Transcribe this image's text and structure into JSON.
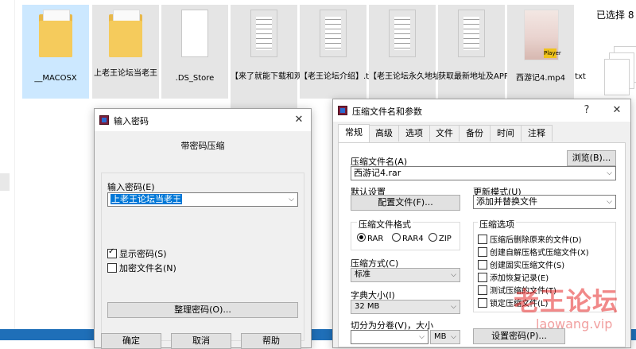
{
  "explorer": {
    "files": [
      {
        "name": "__MACOSX",
        "kind": "folder",
        "selected": true
      },
      {
        "name": "上老王论坛当老王",
        "kind": "folder",
        "selected": false
      },
      {
        "name": ".DS_Store",
        "kind": "doc",
        "selected": false
      },
      {
        "name": "【来了就能下载和观看的论坛,纯免费！】.txt",
        "kind": "txt",
        "selected": false
      },
      {
        "name": "【老王论坛介绍】.txt",
        "kind": "txt",
        "selected": false
      },
      {
        "name": "【老王论坛永久地址发布页】.txt",
        "kind": "txt",
        "selected": false
      },
      {
        "name": "获取最新地址及APP请发邮箱自动获取.txt",
        "kind": "txt",
        "selected": false
      },
      {
        "name": "西游记4.mp4",
        "kind": "video",
        "selected": false
      }
    ],
    "selection_text": "已选择 8",
    "video_badge": "Player"
  },
  "password_dialog": {
    "title": "输入密码",
    "heading": "带密码压缩",
    "input_label": "输入密码(E)",
    "password_value": "上老王论坛当老王",
    "show_password": {
      "label": "显示密码(S)",
      "checked": true
    },
    "encrypt_names": {
      "label": "加密文件名(N)",
      "checked": false
    },
    "organize_button": "整理密码(O)...",
    "ok_button": "确定",
    "cancel_button": "取消",
    "help_button": "帮助"
  },
  "archive_dialog": {
    "title": "压缩文件名和参数",
    "help_glyph": "?",
    "tabs": [
      "常规",
      "高级",
      "选项",
      "文件",
      "备份",
      "时间",
      "注释"
    ],
    "active_tab": 0,
    "archive_name_label": "压缩文件名(A)",
    "browse_button": "浏览(B)...",
    "archive_name_value": "西游记4.rar",
    "default_settings_label": "默认设置",
    "profiles_button": "配置文件(F)...",
    "update_mode_label": "更新模式(U)",
    "update_mode_value": "添加并替换文件",
    "format_group": "压缩文件格式",
    "formats": [
      {
        "label": "RAR",
        "checked": true
      },
      {
        "label": "RAR4",
        "checked": false
      },
      {
        "label": "ZIP",
        "checked": false
      }
    ],
    "method_label": "压缩方式(C)",
    "method_value": "标准",
    "dict_label": "字典大小(I)",
    "dict_value": "32 MB",
    "split_label": "切分为分卷(V)，大小",
    "split_unit": "MB",
    "options_group": "压缩选项",
    "options": [
      {
        "label": "压缩后删除原来的文件(D)",
        "checked": false
      },
      {
        "label": "创建自解压格式压缩文件(X)",
        "checked": false
      },
      {
        "label": "创建固实压缩文件(S)",
        "checked": false
      },
      {
        "label": "添加恢复记录(E)",
        "checked": false
      },
      {
        "label": "测试压缩的文件(T)",
        "checked": false
      },
      {
        "label": "锁定压缩文件(L)",
        "checked": false
      }
    ],
    "set_password_button": "设置密码(P)..."
  },
  "watermark": {
    "text": "老王论坛",
    "url": "laowang.vip"
  }
}
